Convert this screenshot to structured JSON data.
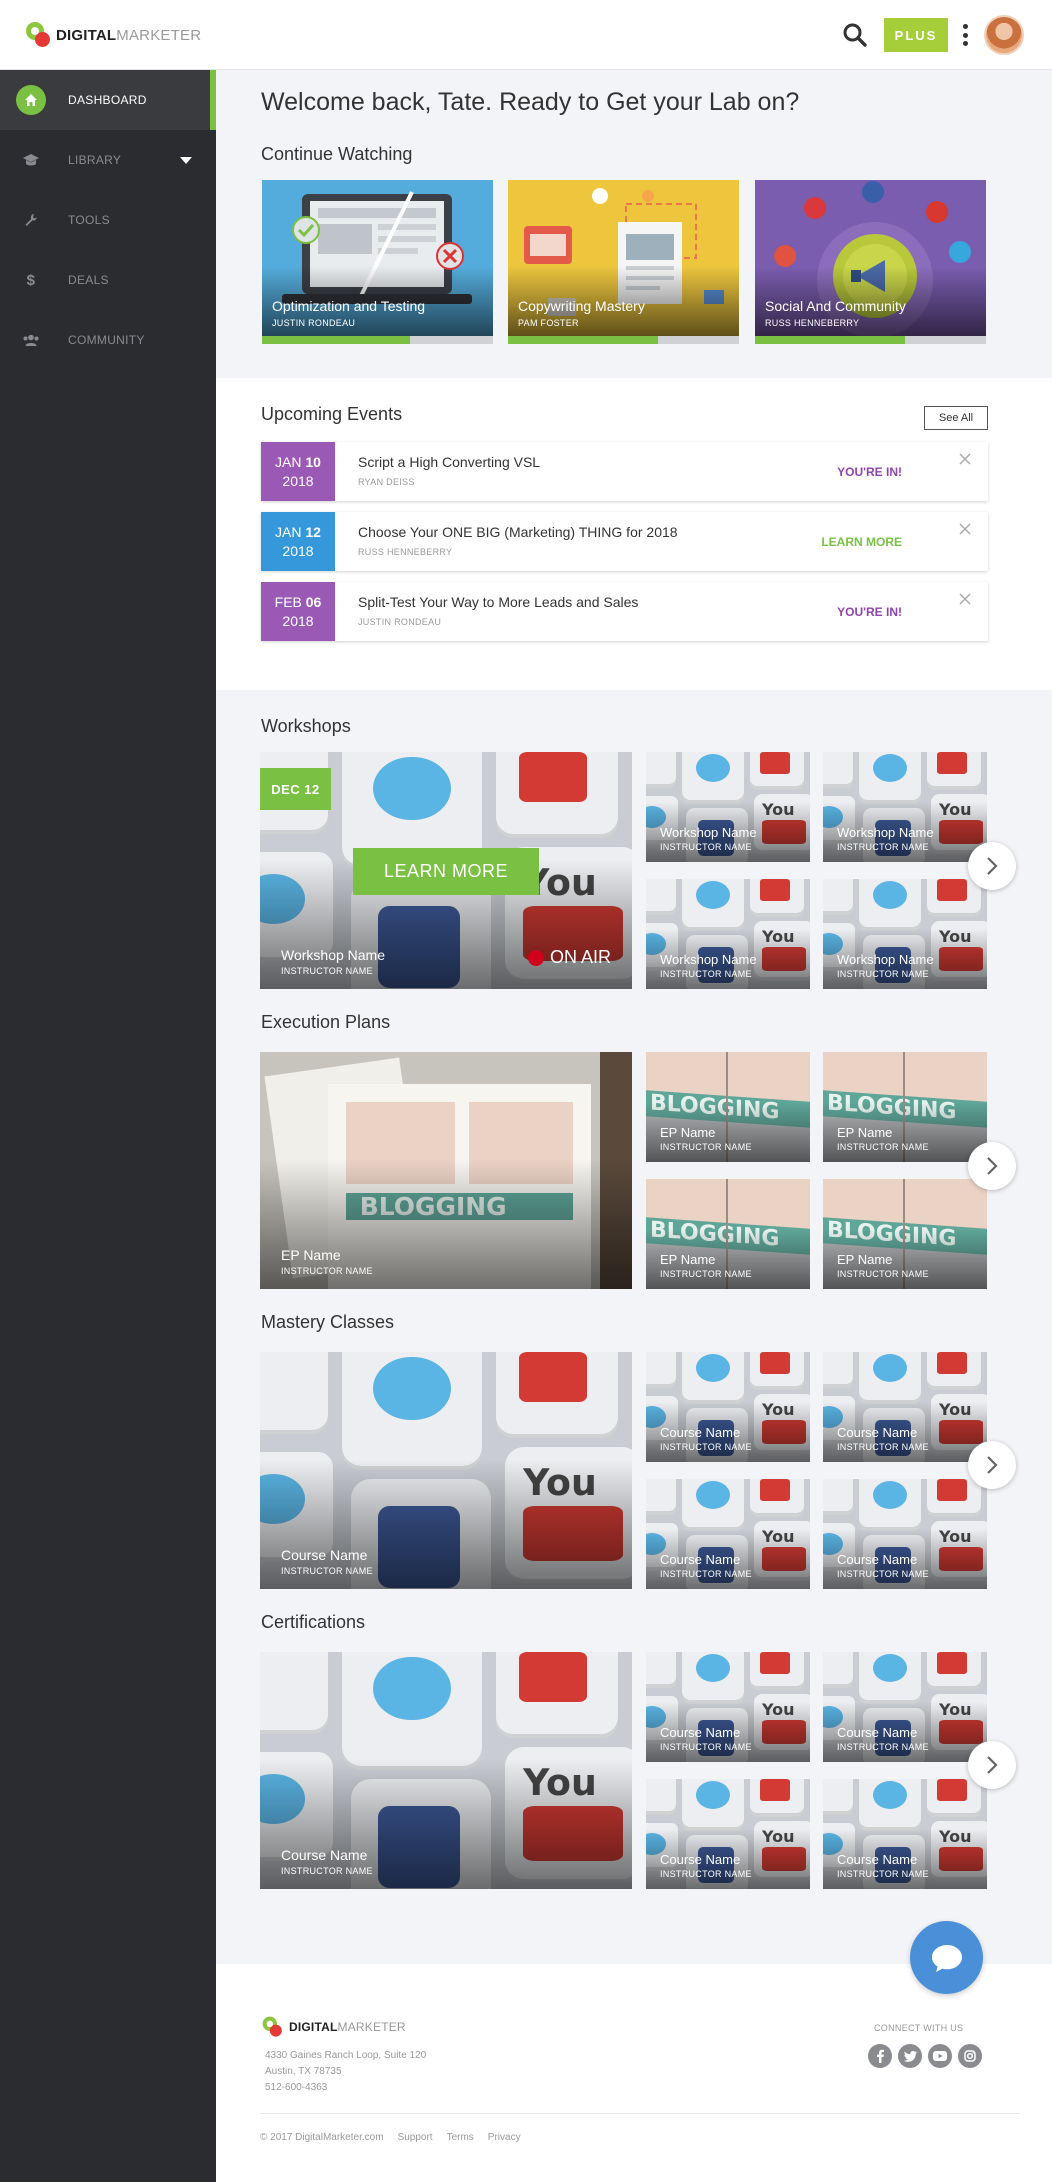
{
  "header": {
    "logo_bold": "DIGITAL",
    "logo_light": "MARKETER",
    "plus_label": "PLUS"
  },
  "sidebar": {
    "items": [
      {
        "label": "DASHBOARD",
        "icon": "home-icon"
      },
      {
        "label": "LIBRARY",
        "icon": "graduation-cap-icon"
      },
      {
        "label": "TOOLS",
        "icon": "wrench-icon"
      },
      {
        "label": "DEALS",
        "icon": "dollar-icon"
      },
      {
        "label": "COMMUNITY",
        "icon": "users-icon"
      }
    ]
  },
  "main": {
    "welcome": "Welcome back, Tate. Ready to Get your Lab on?",
    "continue_watching": {
      "title": "Continue Watching",
      "cards": [
        {
          "title": "Optimization and Testing",
          "author": "JUSTIN RONDEAU",
          "progress": 0.64
        },
        {
          "title": "Copywriting Mastery",
          "author": "PAM FOSTER",
          "progress": 0.65
        },
        {
          "title": "Social And Community",
          "author": "RUSS HENNEBERRY",
          "progress": 0.65
        }
      ]
    },
    "events": {
      "title": "Upcoming Events",
      "see_all": "See All",
      "items": [
        {
          "month": "JAN",
          "day": "10",
          "year": "2018",
          "title": "Script a High Converting VSL",
          "speaker": "RYAN DEISS",
          "status": "YOU'RE IN!",
          "color": "#9b59b6",
          "status_color": "#8e44ad"
        },
        {
          "month": "JAN",
          "day": "12",
          "year": "2018",
          "title": "Choose Your ONE BIG (Marketing) THING for 2018",
          "speaker": "RUSS HENNEBERRY",
          "status": "LEARN MORE",
          "color": "#3498db",
          "status_color": "#7ac143"
        },
        {
          "month": "FEB",
          "day": "06",
          "year": "2018",
          "title": "Split-Test Your Way to More Leads and Sales",
          "speaker": "JUSTIN RONDEAU",
          "status": "YOU'RE IN!",
          "color": "#9b59b6",
          "status_color": "#8e44ad"
        }
      ]
    },
    "workshops": {
      "title": "Workshops",
      "badge": "DEC 12",
      "learn_more": "LEARN MORE",
      "on_air": "ON AIR",
      "featured": {
        "name": "Workshop Name",
        "instructor": "INSTRUCTOR NAME"
      },
      "thumbs": [
        {
          "name": "Workshop Name",
          "instructor": "INSTRUCTOR NAME"
        },
        {
          "name": "Workshop Name",
          "instructor": "INSTRUCTOR NAME"
        },
        {
          "name": "Workshop Name",
          "instructor": "INSTRUCTOR NAME"
        },
        {
          "name": "Workshop Name",
          "instructor": "INSTRUCTOR NAME"
        }
      ]
    },
    "execution_plans": {
      "title": "Execution Plans",
      "featured": {
        "name": "EP Name",
        "instructor": "INSTRUCTOR NAME"
      },
      "thumbs": [
        {
          "name": "EP Name",
          "instructor": "INSTRUCTOR NAME"
        },
        {
          "name": "EP Name",
          "instructor": "INSTRUCTOR NAME"
        },
        {
          "name": "EP Name",
          "instructor": "INSTRUCTOR NAME"
        },
        {
          "name": "EP Name",
          "instructor": "INSTRUCTOR NAME"
        }
      ]
    },
    "mastery_classes": {
      "title": "Mastery Classes",
      "featured": {
        "name": "Course Name",
        "instructor": "INSTRUCTOR NAME"
      },
      "thumbs": [
        {
          "name": "Course Name",
          "instructor": "INSTRUCTOR NAME"
        },
        {
          "name": "Course Name",
          "instructor": "INSTRUCTOR NAME"
        },
        {
          "name": "Course Name",
          "instructor": "INSTRUCTOR NAME"
        },
        {
          "name": "Course Name",
          "instructor": "INSTRUCTOR NAME"
        }
      ]
    },
    "certifications": {
      "title": "Certifications",
      "featured": {
        "name": "Course Name",
        "instructor": "INSTRUCTOR NAME"
      },
      "thumbs": [
        {
          "name": "Course Name",
          "instructor": "INSTRUCTOR NAME"
        },
        {
          "name": "Course Name",
          "instructor": "INSTRUCTOR NAME"
        },
        {
          "name": "Course Name",
          "instructor": "INSTRUCTOR NAME"
        },
        {
          "name": "Course Name",
          "instructor": "INSTRUCTOR NAME"
        }
      ]
    }
  },
  "footer": {
    "logo_bold": "DIGITAL",
    "logo_light": "MARKETER",
    "address": [
      "4330 Gaines Ranch Loop, Suite 120",
      "Austin, TX 78735",
      "512-600-4363"
    ],
    "connect": "CONNECT WITH US",
    "social": [
      "facebook-icon",
      "twitter-icon",
      "youtube-icon",
      "instagram-icon"
    ],
    "copyright": "© 2017 DigitalMarketer.com",
    "links": [
      "Support",
      "Terms",
      "Privacy"
    ]
  },
  "colors": {
    "accent": "#7ac143",
    "plus": "#a6ce39",
    "sidebar": "#2b2c2f",
    "chat": "#4a90d9"
  }
}
